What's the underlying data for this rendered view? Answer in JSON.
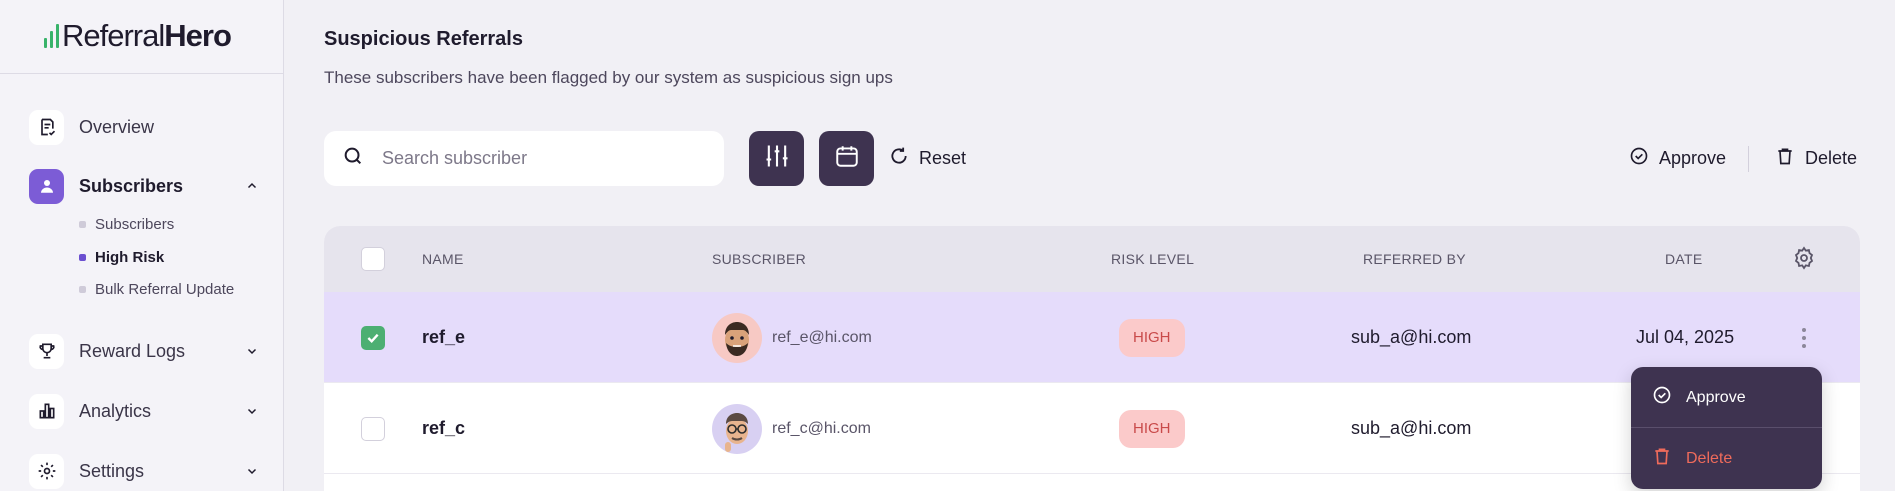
{
  "brand": {
    "name_regular": "Referral",
    "name_bold": "Hero",
    "accent": "#38b36a"
  },
  "sidebar": {
    "items": [
      {
        "label": "Overview",
        "icon": "document-check-icon"
      },
      {
        "label": "Subscribers",
        "icon": "user-icon",
        "active": true,
        "expanded": true
      },
      {
        "label": "Reward Logs",
        "icon": "trophy-icon"
      },
      {
        "label": "Analytics",
        "icon": "bar-chart-icon"
      },
      {
        "label": "Settings",
        "icon": "gear-icon"
      }
    ],
    "subitems": [
      {
        "label": "Subscribers"
      },
      {
        "label": "High Risk",
        "active": true
      },
      {
        "label": "Bulk Referral Update"
      }
    ]
  },
  "page": {
    "title": "Suspicious Referrals",
    "subtitle": "These subscribers have been flagged by our system as suspicious sign ups"
  },
  "toolbar": {
    "search_placeholder": "Search subscriber",
    "reset_label": "Reset",
    "approve_label": "Approve",
    "delete_label": "Delete"
  },
  "table": {
    "headers": {
      "name": "NAME",
      "subscriber": "SUBSCRIBER",
      "risk": "RISK LEVEL",
      "referred_by": "REFERRED BY",
      "date": "DATE"
    },
    "rows": [
      {
        "name": "ref_e",
        "email": "ref_e@hi.com",
        "risk": "HIGH",
        "referred_by": "sub_a@hi.com",
        "date": "Jul 04, 2025",
        "checked": true
      },
      {
        "name": "ref_c",
        "email": "ref_c@hi.com",
        "risk": "HIGH",
        "referred_by": "sub_a@hi.com",
        "date": "",
        "checked": false
      }
    ]
  },
  "row_menu": {
    "approve_label": "Approve",
    "delete_label": "Delete"
  },
  "colors": {
    "primary_dark": "#3e3350",
    "active_purple": "#7c5cd6",
    "selected_row": "#e5dcfb",
    "risk_badge_bg": "#fbcaca",
    "risk_badge_text": "#c94a4a",
    "delete_red": "#ef6b5b"
  }
}
